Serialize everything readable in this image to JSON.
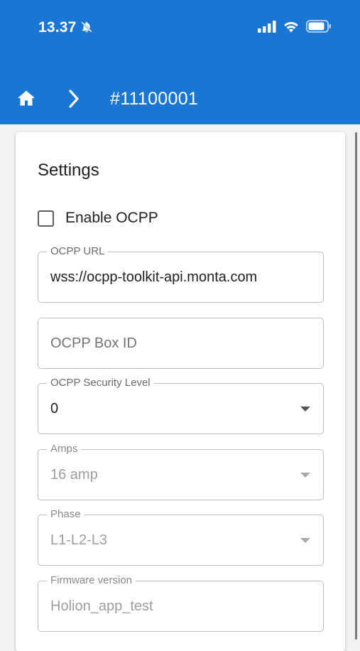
{
  "status_bar": {
    "time": "13.37",
    "icons": [
      "bell-slash-icon",
      "signal-icon",
      "wifi-icon",
      "battery-icon"
    ]
  },
  "header": {
    "breadcrumb_title": "#11100001",
    "icons": [
      "home-icon",
      "chevron-right-icon"
    ],
    "color": "#1976d2"
  },
  "settings": {
    "title": "Settings",
    "enable_ocpp": {
      "label": "Enable OCPP",
      "checked": false
    },
    "ocpp_url": {
      "label": "OCPP URL",
      "value": "wss://ocpp-toolkit-api.monta.com"
    },
    "ocpp_box_id": {
      "placeholder": "OCPP Box ID",
      "value": ""
    },
    "ocpp_security_level": {
      "label": "OCPP Security Level",
      "value": "0"
    },
    "amps": {
      "label": "Amps",
      "value": "16 amp",
      "disabled": true
    },
    "phase": {
      "label": "Phase",
      "value": "L1-L2-L3",
      "disabled": true
    },
    "firmware_version": {
      "label": "Firmware version",
      "value": "Holion_app_test",
      "disabled": true
    }
  }
}
